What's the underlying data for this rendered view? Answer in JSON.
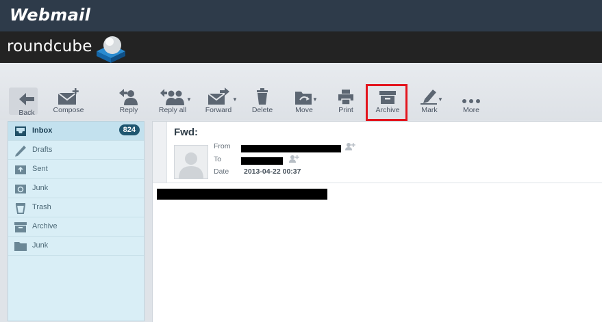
{
  "header": {
    "brand": "Webmail",
    "product": "roundcube"
  },
  "toolbar": {
    "back": "Back",
    "compose": "Compose",
    "reply": "Reply",
    "reply_all": "Reply all",
    "forward": "Forward",
    "delete": "Delete",
    "move": "Move",
    "print": "Print",
    "archive": "Archive",
    "mark": "Mark",
    "more": "More"
  },
  "folders": [
    {
      "name": "Inbox",
      "icon": "inbox-icon",
      "count": "824",
      "selected": true
    },
    {
      "name": "Drafts",
      "icon": "pencil-icon"
    },
    {
      "name": "Sent",
      "icon": "sent-tray-icon"
    },
    {
      "name": "Junk",
      "icon": "junk-recycle-icon"
    },
    {
      "name": "Trash",
      "icon": "trash-icon"
    },
    {
      "name": "Archive",
      "icon": "archive-box-icon"
    },
    {
      "name": "Junk",
      "icon": "folder-icon"
    }
  ],
  "message": {
    "subject": "Fwd:",
    "from_label": "From",
    "to_label": "To",
    "date_label": "Date",
    "date": "2013-04-22 00:37"
  },
  "colors": {
    "highlight": "#e3141d",
    "badge": "#1f5670",
    "topbar": "#2e3b4a"
  }
}
